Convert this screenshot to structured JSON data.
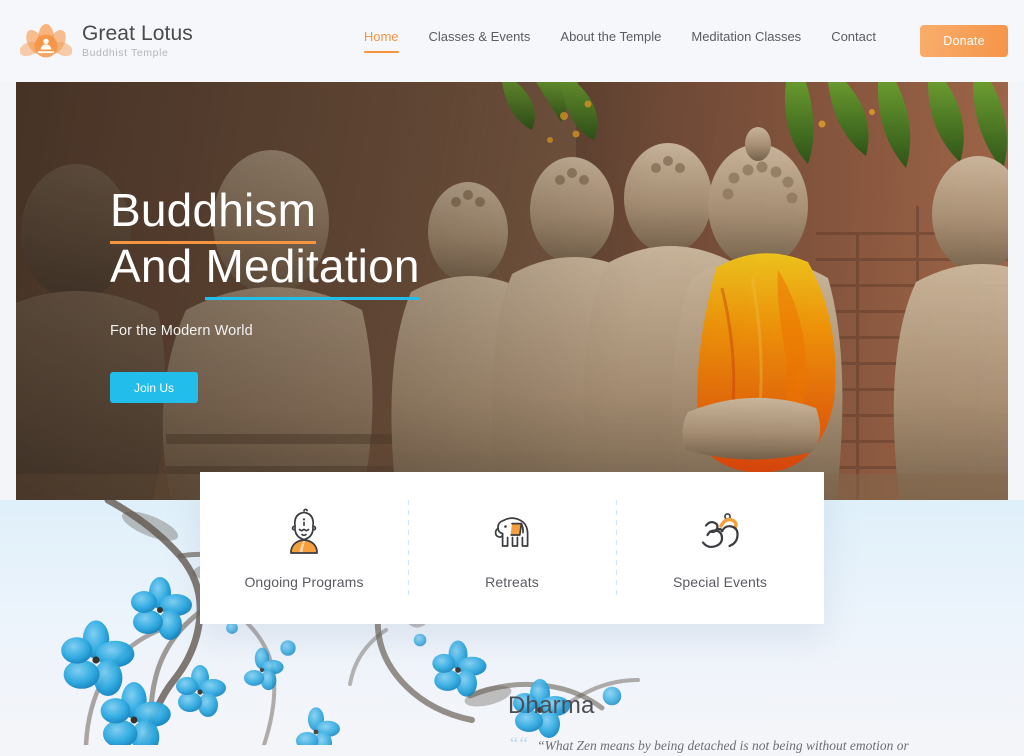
{
  "brand": {
    "title": "Great Lotus",
    "subtitle": "Buddhist Temple",
    "logo_icon": "lotus-meditation-icon"
  },
  "nav": {
    "items": [
      {
        "label": "Home",
        "active": true
      },
      {
        "label": "Classes & Events",
        "active": false
      },
      {
        "label": "About the Temple",
        "active": false
      },
      {
        "label": "Meditation Classes",
        "active": false
      },
      {
        "label": "Contact",
        "active": false
      }
    ],
    "donate_label": "Donate"
  },
  "hero": {
    "headline_line1": "Buddhism",
    "headline_line2_prefix": "And ",
    "headline_line2_underlined": "Meditation",
    "subtitle": "For the Modern World",
    "cta_label": "Join Us",
    "image_alt": "Row of seated stone Buddha statues, one draped in an orange robe, against a brick wall with green foliage"
  },
  "features": [
    {
      "label": "Ongoing Programs",
      "icon": "buddha-head-icon"
    },
    {
      "label": "Retreats",
      "icon": "elephant-icon"
    },
    {
      "label": "Special Events",
      "icon": "om-symbol-icon"
    }
  ],
  "dharma": {
    "title": "Dharma",
    "quote_mark": "““",
    "quote": "“What Zen means by being detached is not being without emotion or"
  },
  "decor": {
    "blossom_alt": "Blue ink-wash cherry blossom branches"
  },
  "colors": {
    "accent_orange": "#f5953f",
    "accent_cyan": "#22bdea",
    "page_bg": "#f4f5f9",
    "header_bg": "#f6f7fa",
    "text_dark": "#4c4c54"
  }
}
